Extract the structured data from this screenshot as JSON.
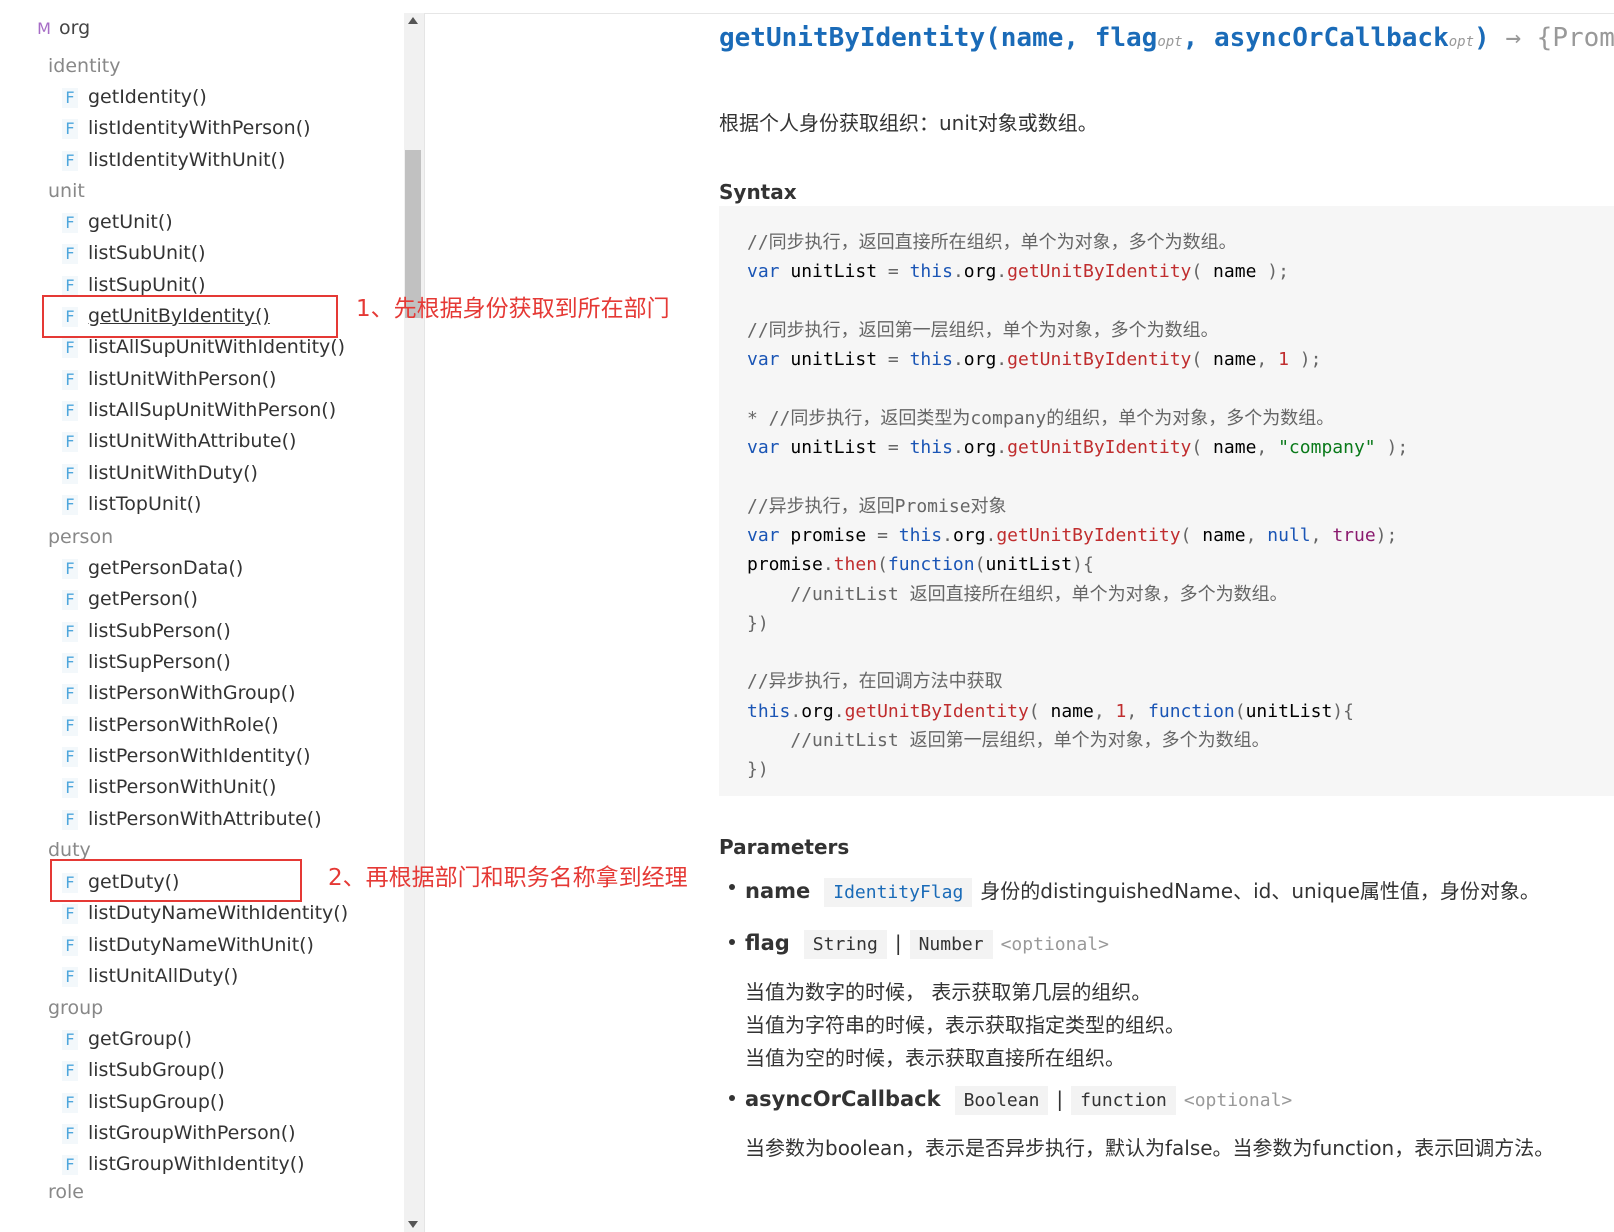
{
  "sidebar": {
    "module": {
      "badge": "M",
      "label": "org"
    },
    "categories": {
      "identity": "identity",
      "unit": "unit",
      "person": "person",
      "duty": "duty",
      "group": "group",
      "role": "role"
    },
    "fn_badge": "F",
    "identity_items": [
      "getIdentity()",
      "listIdentityWithPerson()",
      "listIdentityWithUnit()"
    ],
    "unit_items": [
      "getUnit()",
      "listSubUnit()",
      "listSupUnit()",
      "getUnitByIdentity()",
      "listAllSupUnitWithIdentity()",
      "listUnitWithPerson()",
      "listAllSupUnitWithPerson()",
      "listUnitWithAttribute()",
      "listUnitWithDuty()",
      "listTopUnit()"
    ],
    "person_items": [
      "getPersonData()",
      "getPerson()",
      "listSubPerson()",
      "listSupPerson()",
      "listPersonWithGroup()",
      "listPersonWithRole()",
      "listPersonWithIdentity()",
      "listPersonWithUnit()",
      "listPersonWithAttribute()"
    ],
    "duty_items": [
      "getDuty()",
      "listDutyNameWithIdentity()",
      "listDutyNameWithUnit()",
      "listUnitAllDuty()"
    ],
    "group_items": [
      "getGroup()",
      "listSubGroup()",
      "listSupGroup()",
      "listGroupWithPerson()",
      "listGroupWithIdentity()"
    ]
  },
  "annotations": {
    "note1": "1、先根据身份获取到所在部门",
    "note2": "2、再根据部门和职务名称拿到经理"
  },
  "main": {
    "signature": {
      "fn": "getUnitByIdentity(",
      "p1": "name,",
      "p2": "flag",
      "opt": "opt",
      "comma": ",",
      "p3": "asyncOrCallback",
      "close": ")",
      "ret": "→ {Prom"
    },
    "description": "根据个人身份获取组织：unit对象或数组。",
    "syntax_heading": "Syntax",
    "params_heading": "Parameters",
    "params": {
      "name": {
        "name": "name",
        "type": "IdentityFlag",
        "desc": "身份的distinguishedName、id、unique属性值，身份对象。"
      },
      "flag": {
        "name": "flag",
        "type1": "String",
        "sep": "|",
        "type2": "Number",
        "optional": "<optional>",
        "lines": [
          "当值为数字的时候， 表示获取第几层的组织。",
          "当值为字符串的时候，表示获取指定类型的组织。",
          "当值为空的时候，表示获取直接所在组织。"
        ]
      },
      "async": {
        "name": "asyncOrCallback",
        "type1": "Boolean",
        "sep": "|",
        "type2": "function",
        "optional": "<optional>",
        "desc": "当参数为boolean，表示是否异步执行，默认为false。当参数为function，表示回调方法。"
      }
    }
  },
  "colors": {
    "accent": "#1a6bb8",
    "annotation": "#e53935",
    "fn_badge": "#4ea6dc",
    "module_badge": "#a66cc6"
  }
}
